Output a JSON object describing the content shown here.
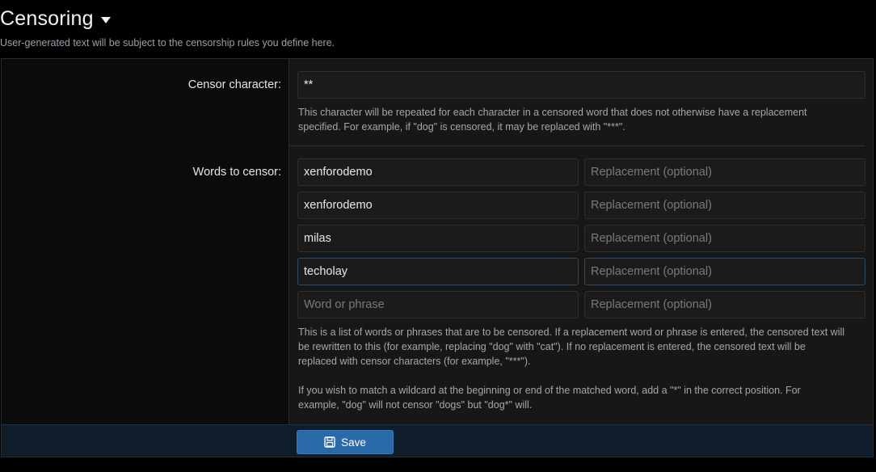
{
  "header": {
    "title": "Censoring",
    "description": "User-generated text will be subject to the censorship rules you define here."
  },
  "censor_character": {
    "label": "Censor character:",
    "value": "**",
    "hint_line1": "This character will be repeated for each character in a censored word that does not otherwise have a replacement",
    "hint_line2": "specified. For example, if \"dog\" is censored, it may be replaced with \"***\"."
  },
  "words": {
    "label": "Words to censor:",
    "word_placeholder": "Word or phrase",
    "replacement_placeholder": "Replacement (optional)",
    "rows": [
      {
        "word": "xenforodemo",
        "replacement": ""
      },
      {
        "word": "xenforodemo",
        "replacement": ""
      },
      {
        "word": "milas",
        "replacement": ""
      },
      {
        "word": "techolay",
        "replacement": ""
      },
      {
        "word": "",
        "replacement": ""
      }
    ],
    "hint_p1_line1": "This is a list of words or phrases that are to be censored. If a replacement word or phrase is entered, the censored text will",
    "hint_p1_line2": "be rewritten to this (for example, replacing \"dog\" with \"cat\"). If no replacement is entered, the censored text will be",
    "hint_p1_line3": "replaced with censor characters (for example, \"***\").",
    "hint_p2_line1": "If you wish to match a wildcard at the beginning or end of the matched word, add a \"*\" in the correct position. For",
    "hint_p2_line2": "example, \"dog\" will not censor \"dogs\" but \"dog*\" will."
  },
  "footer": {
    "save_label": "Save",
    "save_icon": "save-icon"
  },
  "colors": {
    "accent": "#2b6aa8",
    "footer_bg": "#0f1c2a",
    "panel_bg": "#171717"
  }
}
